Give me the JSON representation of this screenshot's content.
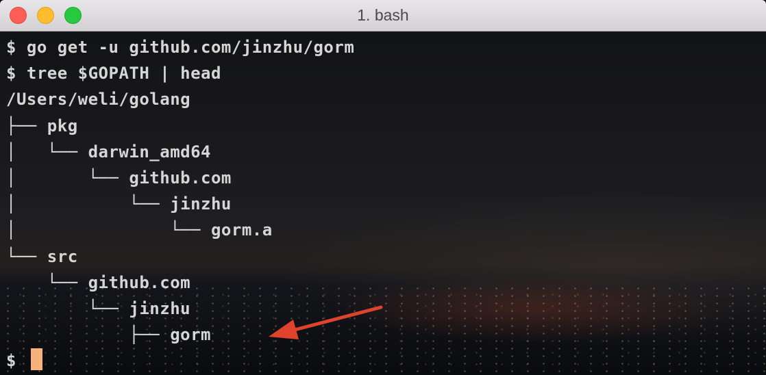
{
  "window": {
    "title": "1. bash",
    "colors": {
      "close": "#fd5f57",
      "minimize": "#febc2e",
      "zoom": "#28c840"
    }
  },
  "terminal": {
    "lines": [
      "$ go get -u github.com/jinzhu/gorm",
      "$ tree $GOPATH | head",
      "/Users/weli/golang",
      "├── pkg",
      "│   └── darwin_amd64",
      "│       └── github.com",
      "│           └── jinzhu",
      "│               └── gorm.a",
      "└── src",
      "    └── github.com",
      "        └── jinzhu",
      "            ├── gorm",
      "$ "
    ],
    "cursor_color": "#f6b27a",
    "annotation_arrow_color": "#e0432c"
  }
}
